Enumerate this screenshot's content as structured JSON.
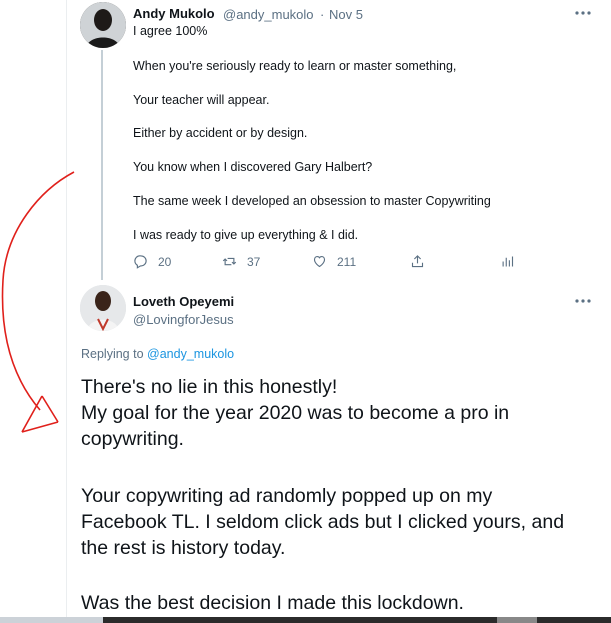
{
  "tweet1": {
    "name": "Andy Mukolo",
    "handle": "@andy_mukolo",
    "separator": "·",
    "date": "Nov 5",
    "more_icon": "more-horizontal-icon",
    "lines": [
      "I agree 100%",
      "When you're seriously ready to learn or master something,",
      "Your teacher will appear.",
      "Either by accident or by design.",
      "You know when I discovered Gary Halbert?",
      "The same week I developed an obsession to master Copywriting",
      "I was ready to give up everything & I did."
    ],
    "actions": {
      "reply_count": "20",
      "retweet_count": "37",
      "like_count": "211",
      "reply_icon": "reply-icon",
      "retweet_icon": "retweet-icon",
      "like_icon": "heart-icon",
      "share_icon": "share-icon",
      "analytics_icon": "analytics-icon"
    }
  },
  "tweet2": {
    "name": "Loveth Opeyemi",
    "handle": "@LovingforJesus",
    "more_icon": "more-horizontal-icon",
    "replying_prefix": "Replying to",
    "replying_mention": "@andy_mukolo",
    "lines": [
      "There's no lie in this honestly!",
      "My goal for the year 2020 was to become a pro in",
      "copywriting.",
      "Your copywriting ad randomly popped up on my",
      "Facebook TL. I seldom click ads but I clicked yours, and",
      "the rest is history today.",
      "Was the best decision I made this lockdown."
    ]
  },
  "colors": {
    "text": "#0f1419",
    "secondary": "#5b7083",
    "link": "#1b95e0",
    "annotation": "#e0201b"
  }
}
